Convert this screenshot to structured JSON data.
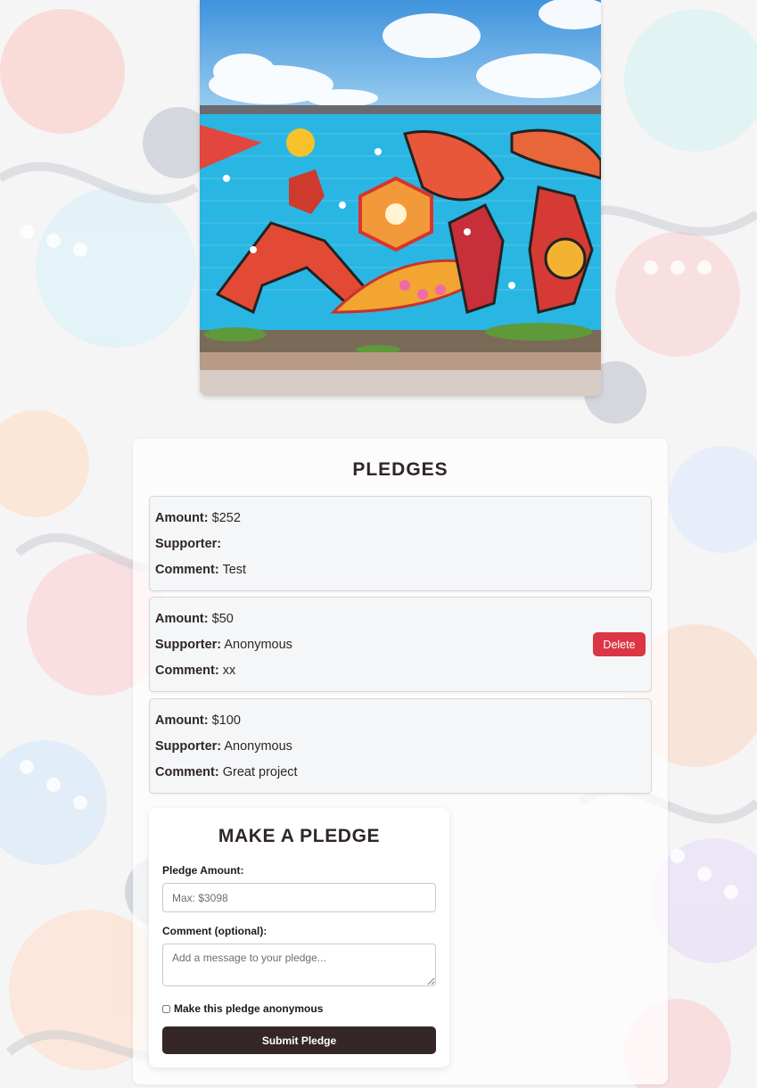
{
  "colors": {
    "accent_dark": "#352727",
    "delete": "#dc3545",
    "card_bg": "#f5f6f8"
  },
  "hero": {
    "image_icon": "kangaroo-mural-image"
  },
  "pledges": {
    "title": "PLEDGES",
    "label_amount": "Amount:",
    "label_supporter": "Supporter:",
    "label_comment": "Comment:",
    "items": [
      {
        "amount": "$252",
        "supporter": "",
        "comment": "Test",
        "deletable": false
      },
      {
        "amount": "$50",
        "supporter": "Anonymous",
        "comment": "xx",
        "deletable": true
      },
      {
        "amount": "$100",
        "supporter": "Anonymous",
        "comment": "Great project",
        "deletable": false
      }
    ],
    "delete_label": "Delete"
  },
  "form": {
    "title": "MAKE A PLEDGE",
    "amount_label": "Pledge Amount:",
    "amount_placeholder": "Max: $3098",
    "comment_label": "Comment (optional):",
    "comment_placeholder": "Add a message to your pledge...",
    "anonymous_label": "Make this pledge anonymous",
    "anonymous_checked": false,
    "submit_label": "Submit Pledge"
  }
}
